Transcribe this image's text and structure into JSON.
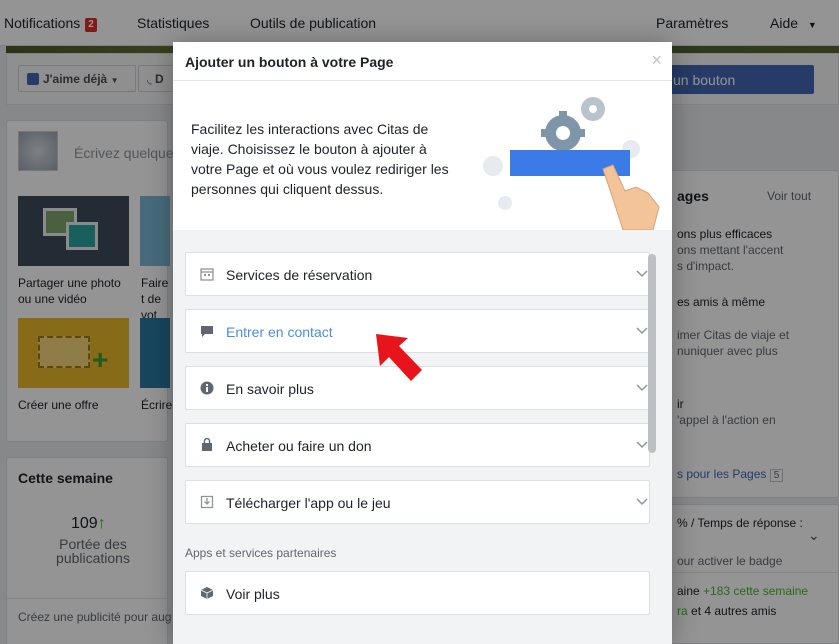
{
  "topnav": {
    "notifications_label": "Notifications",
    "notifications_count": "2",
    "stats_label": "Statistiques",
    "tools_label": "Outils de publication",
    "settings_label": "Paramètres",
    "help_label": "Aide"
  },
  "actionbar": {
    "like_label": "J'aime déjà",
    "follow_label": "D",
    "cta_label": "un bouton"
  },
  "composer": {
    "placeholder": "Écrivez quelque"
  },
  "tiles": [
    {
      "label": "Partager une photo ou une vidéo"
    },
    {
      "label": "Faire t de vot"
    },
    {
      "label": "Créer une offre"
    },
    {
      "label": "Écrire"
    }
  ],
  "week": {
    "title": "Cette semaine",
    "reach_value": "109",
    "reach_label": "Portée des publications",
    "ad_text": "Créez une publicité pour aug"
  },
  "right": {
    "pages_title": "ages",
    "see_all": "Voir tout",
    "item1_title": "ons plus efficaces",
    "item1_line1": "ons mettant l'accent",
    "item1_line2": "s d'impact.",
    "item2_title": "es amis à même",
    "item2_line1": "imer Citas de viaje et",
    "item2_line2": "nuniquer avec plus",
    "item3_title": "ir",
    "item3_line1": "'appel à l'action en",
    "pages_link": "s pour les Pages",
    "pages_count": "5",
    "response_title": "% / Temps de réponse :",
    "response_text": "our activer le badge",
    "likes_text_a": "aine",
    "likes_text_b": "+183 cette semaine",
    "friends_text_a": "ra",
    "friends_text_b": "et 4 autres amis"
  },
  "dialog": {
    "title": "Ajouter un bouton à votre Page",
    "close_glyph": "×",
    "intro": "Facilitez les interactions avec Citas de viaje. Choisissez le bouton à ajouter à votre Page et où vous voulez rediriger les personnes qui cliquent dessus.",
    "options": [
      {
        "label": "Services de réservation",
        "icon": "calendar-icon"
      },
      {
        "label": "Entrer en contact",
        "icon": "chat-bubble-icon",
        "highlighted": true
      },
      {
        "label": "En savoir plus",
        "icon": "info-icon"
      },
      {
        "label": "Acheter ou faire un don",
        "icon": "shopping-bag-icon"
      },
      {
        "label": "Télécharger l'app ou le jeu",
        "icon": "download-icon"
      }
    ],
    "partners_heading": "Apps et services partenaires",
    "see_more_label": "Voir plus",
    "see_more_icon": "cube-icon"
  },
  "colors": {
    "accent_blue": "#4267b2",
    "highlight_text": "#4a90d9",
    "arrow_red": "#e8141b",
    "illustration_blue": "#3b7be8",
    "green": "#42b72a"
  }
}
